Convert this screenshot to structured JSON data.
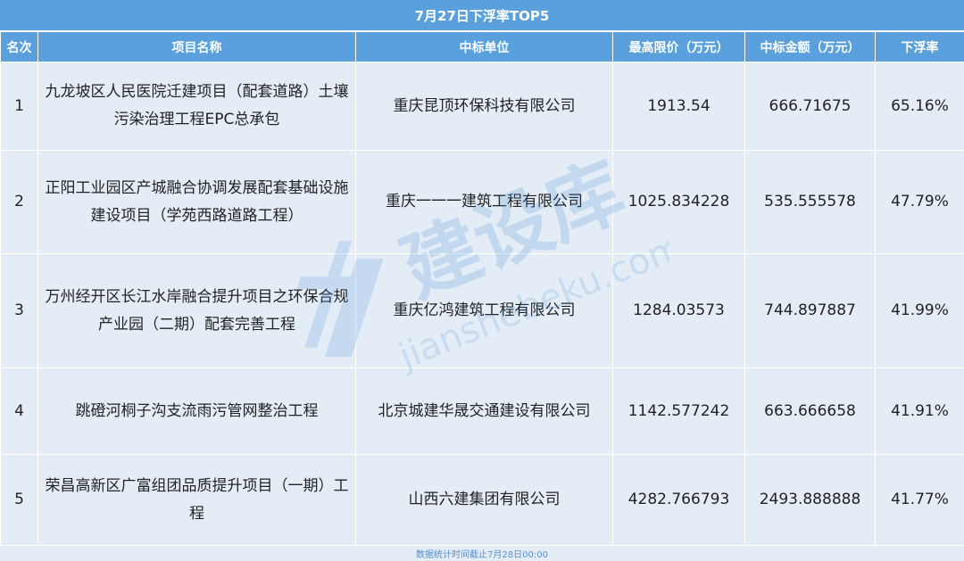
{
  "title": "7月27日下浮率TOP5",
  "headers": [
    "名次",
    "项目名称",
    "中标单位",
    "最高限价（万元）",
    "中标金额（万元）",
    "下浮率"
  ],
  "rows": [
    {
      "rank": "1",
      "project": "九龙坡区人民医院迁建项目（配套道路）土壤污染治理工程EPC总承包",
      "winner": "重庆昆顶环保科技有限公司",
      "max_price": "1913.54",
      "bid_amount": "666.71675",
      "discount_rate": "65.16%"
    },
    {
      "rank": "2",
      "project": "正阳工业园区产城融合协调发展配套基础设施建设项目（学苑西路道路工程）",
      "winner": "重庆一一一建筑工程有限公司",
      "max_price": "1025.834228",
      "bid_amount": "535.555578",
      "discount_rate": "47.79%"
    },
    {
      "rank": "3",
      "project": "万州经开区长江水岸融合提升项目之环保合规产业园（二期）配套完善工程",
      "winner": "重庆亿鸿建筑工程有限公司",
      "max_price": "1284.03573",
      "bid_amount": "744.897887",
      "discount_rate": "41.99%"
    },
    {
      "rank": "4",
      "project": "跳磴河桐子沟支流雨污管网整治工程",
      "winner": "北京城建华晟交通建设有限公司",
      "max_price": "1142.577242",
      "bid_amount": "663.666658",
      "discount_rate": "41.91%"
    },
    {
      "rank": "5",
      "project": "荣昌高新区广富组团品质提升项目（一期）工程",
      "winner": "山西六建集团有限公司",
      "max_price": "4282.766793",
      "bid_amount": "2493.888888",
      "discount_rate": "41.77%"
    }
  ],
  "footer": "数据统计时间截止7月28日00:00",
  "watermark": {
    "brand": "建设库",
    "url": "jianshebeku.com"
  },
  "colors": {
    "header_bg": "#5aa0dc",
    "cell_bg": "#e4edf6",
    "footer_text": "#5a8fc8"
  }
}
